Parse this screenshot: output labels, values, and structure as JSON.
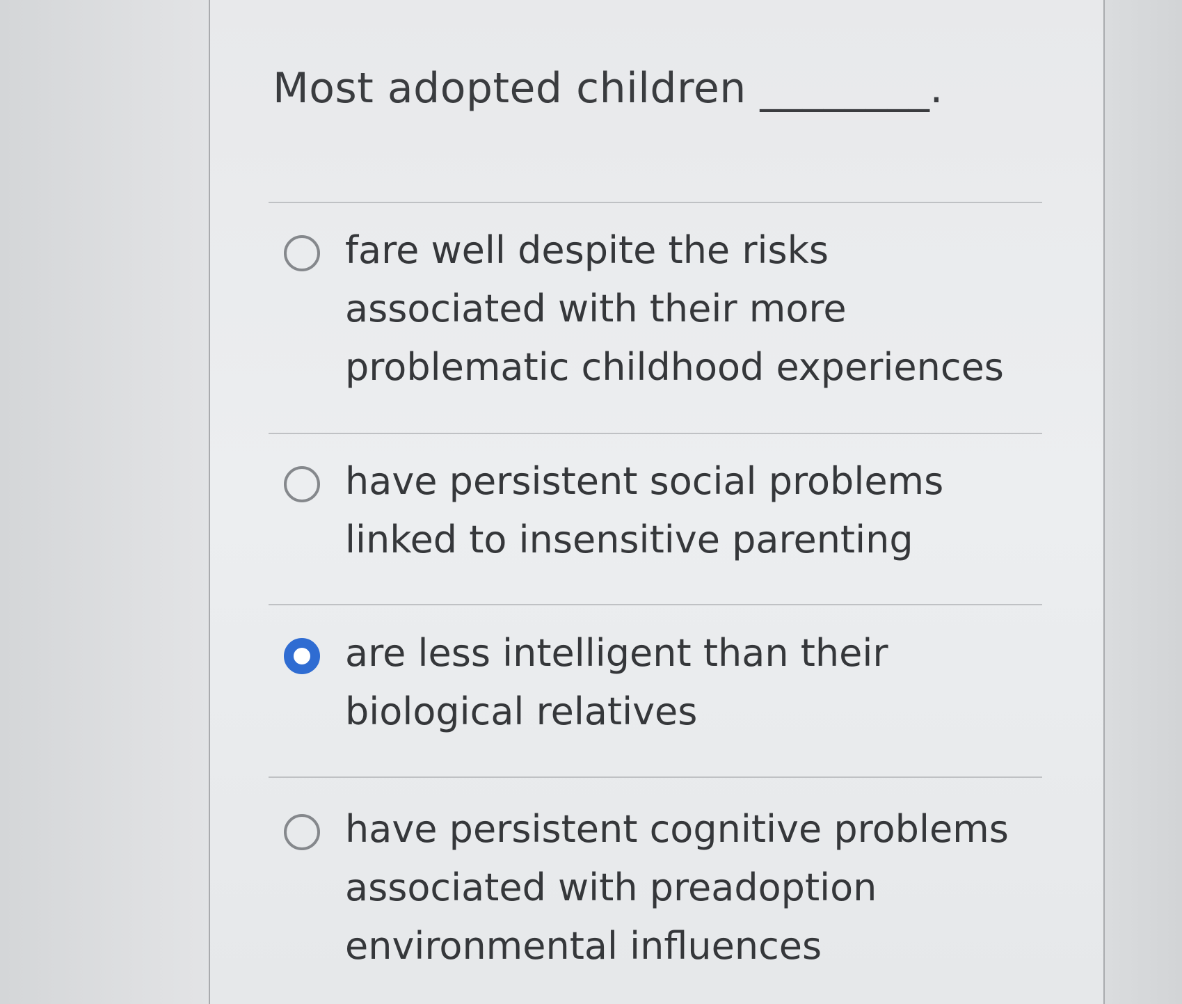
{
  "question": {
    "text": "Most adopted children ________."
  },
  "options": [
    {
      "label": "fare well despite the risks associated with their more problematic childhood experiences",
      "selected": false
    },
    {
      "label": "have persistent social problems linked to insensitive parenting",
      "selected": false
    },
    {
      "label": "are less intelligent than their biological relatives",
      "selected": true
    },
    {
      "label": "have persistent cognitive problems associated with preadoption environmental influences",
      "selected": false
    }
  ],
  "colors": {
    "selected_radio": "#2f6cd2",
    "text": "#35373a",
    "divider": "#bfc1c4"
  }
}
